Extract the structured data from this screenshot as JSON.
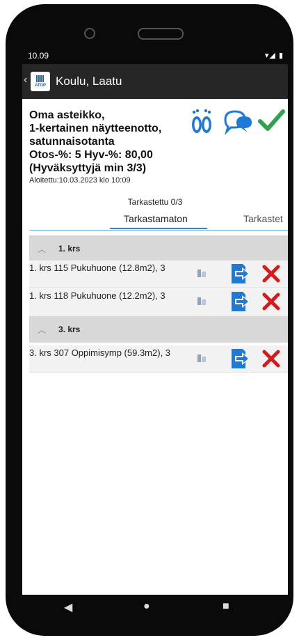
{
  "status_bar": {
    "time": "10.09",
    "icons": "▾◢ ▮"
  },
  "app_bar": {
    "logo_text": "ATOP",
    "title": "Koulu, Laatu",
    "back_icon": "chevron-left-icon"
  },
  "inspection": {
    "lines": [
      "Oma asteikko,",
      "1-kertainen näytteenotto,",
      "satunnaisotanta",
      "Otos-%: 5 Hyv-%: 80,00",
      "(Hyväksyttyjä min 3/3)"
    ],
    "started": "Aloitettu:10.03.2023 klo 10:09",
    "counter": "Tarkastettu 0/3"
  },
  "actions": {
    "people_icon": "footprints-icon",
    "comment_icon": "speech-bubbles-icon",
    "approve_icon": "checkmark-icon"
  },
  "tabs": [
    {
      "label": "Tarkastamaton",
      "active": true
    },
    {
      "label": "Tarkastet",
      "active": false
    }
  ],
  "groups": [
    {
      "label": "1. krs",
      "items": [
        {
          "text": "1. krs 115 Pukuhuone (12.8m2), 3"
        },
        {
          "text": "1. krs 118 Pukuhuone (12.2m2), 3"
        }
      ]
    },
    {
      "label": "3. krs",
      "items": [
        {
          "text": "3. krs 307 Oppimisymp (59.3m2), 3"
        }
      ]
    }
  ],
  "colors": {
    "accent_blue": "#1e7ad6",
    "approve_green": "#2fa24a",
    "delete_red": "#d7191c",
    "app_bar": "#262626",
    "group_bg": "#d8d8d8"
  },
  "nav": {
    "back": "◀",
    "home": "●",
    "recents": "■"
  }
}
